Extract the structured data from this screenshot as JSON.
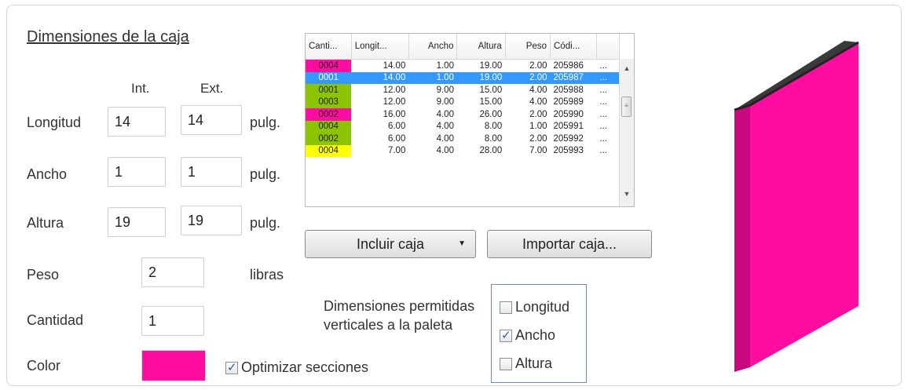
{
  "section_title": "Dimensiones de la caja",
  "headers": {
    "int": "Int.",
    "ext": "Ext."
  },
  "fields": {
    "longitud": {
      "label": "Longitud",
      "int": "14",
      "ext": "14",
      "unit": "pulg."
    },
    "ancho": {
      "label": "Ancho",
      "int": "1",
      "ext": "1",
      "unit": "pulg."
    },
    "altura": {
      "label": "Altura",
      "int": "19",
      "ext": "19",
      "unit": "pulg."
    },
    "peso": {
      "label": "Peso",
      "value": "2",
      "unit": "libras"
    },
    "cantidad": {
      "label": "Cantidad",
      "value": "1"
    },
    "color": {
      "label": "Color",
      "value": "#ff0ca0"
    }
  },
  "optimize": {
    "label": "Optimizar secciones",
    "checked": true
  },
  "table": {
    "columns": [
      "Canti...",
      "Longit...",
      "Ancho",
      "Altura",
      "Peso",
      "Códi..."
    ],
    "rows": [
      {
        "qty": "0004",
        "longitud": "14.00",
        "ancho": "1.00",
        "altura": "19.00",
        "peso": "2.00",
        "codigo": "205986",
        "more": "...",
        "color": "#ff0ca0",
        "selected": false
      },
      {
        "qty": "0001",
        "longitud": "14.00",
        "ancho": "1.00",
        "altura": "19.00",
        "peso": "2.00",
        "codigo": "205987",
        "more": "...",
        "color": "#3399ff",
        "selected": true
      },
      {
        "qty": "0001",
        "longitud": "12.00",
        "ancho": "9.00",
        "altura": "15.00",
        "peso": "4.00",
        "codigo": "205988",
        "more": "...",
        "color": "#8cc500",
        "selected": false
      },
      {
        "qty": "0003",
        "longitud": "12.00",
        "ancho": "9.00",
        "altura": "15.00",
        "peso": "4.00",
        "codigo": "205989",
        "more": "...",
        "color": "#8cc500",
        "selected": false
      },
      {
        "qty": "0002",
        "longitud": "16.00",
        "ancho": "4.00",
        "altura": "26.00",
        "peso": "2.00",
        "codigo": "205990",
        "more": "...",
        "color": "#ff0ca0",
        "selected": false
      },
      {
        "qty": "0004",
        "longitud": "6.00",
        "ancho": "4.00",
        "altura": "8.00",
        "peso": "1.00",
        "codigo": "205991",
        "more": "...",
        "color": "#8cc500",
        "selected": false
      },
      {
        "qty": "0002",
        "longitud": "6.00",
        "ancho": "4.00",
        "altura": "8.00",
        "peso": "2.00",
        "codigo": "205992",
        "more": "...",
        "color": "#8cc500",
        "selected": false
      },
      {
        "qty": "0004",
        "longitud": "7.00",
        "ancho": "4.00",
        "altura": "28.00",
        "peso": "7.00",
        "codigo": "205993",
        "more": "...",
        "color": "#ffff00",
        "selected": false
      }
    ]
  },
  "buttons": {
    "incluir": "Incluir caja",
    "importar": "Importar caja..."
  },
  "allowed": {
    "label_line1": "Dimensiones permitidas",
    "label_line2": "verticales a la paleta",
    "options": [
      {
        "label": "Longitud",
        "checked": false
      },
      {
        "label": "Ancho",
        "checked": true
      },
      {
        "label": "Altura",
        "checked": false
      }
    ]
  },
  "preview_color": "#ff0ca0"
}
